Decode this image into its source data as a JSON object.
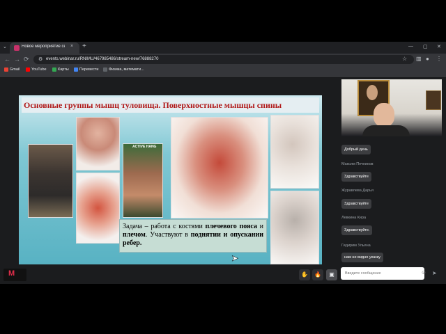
{
  "browser": {
    "tab_title": "Новое мероприятие сете",
    "tab_close": "×",
    "new_tab": "+",
    "tab_list": "⌄",
    "window_controls": [
      "—",
      "▢",
      "✕"
    ],
    "nav": {
      "back": "←",
      "forward": "→",
      "reload": "⟳"
    },
    "url": "events.webinar.ru/RNIMU/467985486/stream-new/76888270",
    "bookmarks": [
      {
        "label": "Gmail",
        "color": "#ea4335"
      },
      {
        "label": "YouTube",
        "color": "#ff0000"
      },
      {
        "label": "Карты",
        "color": "#34a853"
      },
      {
        "label": "Перевести",
        "color": "#4285f4"
      },
      {
        "label": "Физика, математи...",
        "color": "#5f6368"
      }
    ]
  },
  "slide": {
    "title": "Основные группы мышц туловища. Поверхностные мышцы спины",
    "active_label": "ACTIVE HANG",
    "task": {
      "p1": "Задача – работа с костями ",
      "b1": "плечевого пояса",
      "p2": " и ",
      "b2": "плечом",
      "p3": ". Участвуют в ",
      "b3": "поднятии и опускании ребер."
    }
  },
  "chat": {
    "messages": [
      {
        "name": "",
        "text": "Добрый день"
      },
      {
        "name": "Максим Печников",
        "text": "Здравствуйте"
      },
      {
        "name": "Журавлева Дарья",
        "text": "Здравствуйте"
      },
      {
        "name": "Левкина Кира",
        "text": "Здравствуйте."
      },
      {
        "name": "Гидирим Ульяна",
        "text": "нам не видно указку"
      }
    ],
    "input_placeholder": "Введите сообщение"
  },
  "controls": {
    "logo_letter": "M",
    "hand": "✋",
    "fire": "🔥",
    "screen": "▣"
  },
  "colors": {
    "slide_title": "#b01818",
    "logo": "#e12d4a"
  }
}
